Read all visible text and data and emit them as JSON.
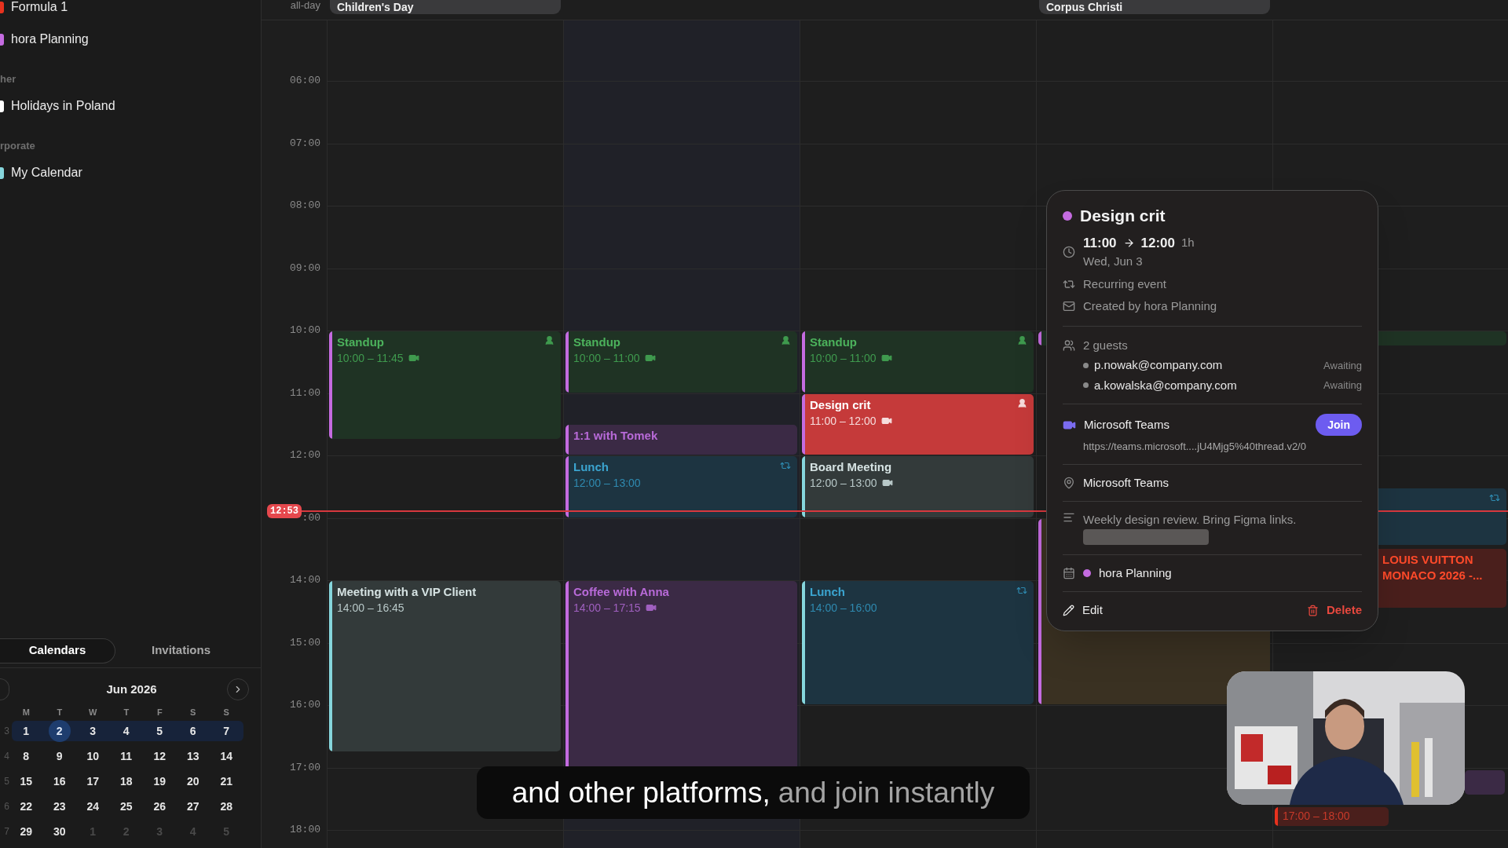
{
  "sidebar": {
    "calendars": [
      {
        "kind": "calendar",
        "name": "Formula 1",
        "color": "#e8321e"
      },
      {
        "kind": "calendar",
        "name": "hora Planning",
        "color": "#c46be0"
      },
      {
        "kind": "section",
        "name": "her"
      },
      {
        "kind": "calendar",
        "name": "Holidays in Poland",
        "color": "#ffffff"
      },
      {
        "kind": "section",
        "name": "rporate"
      },
      {
        "kind": "calendar",
        "name": "My Calendar",
        "color": "#86d6dc"
      }
    ],
    "tabs": [
      {
        "label": "Calendars",
        "selected": true
      },
      {
        "label": "Invitations",
        "selected": false
      }
    ]
  },
  "mini_calendar": {
    "month": "Jun 2026",
    "weekdays": [
      "M",
      "T",
      "W",
      "T",
      "F",
      "S",
      "S"
    ],
    "weeks": [
      {
        "number": "3",
        "selected": true,
        "days": [
          {
            "label": "1",
            "today": false,
            "outside": false
          },
          {
            "label": "2",
            "today": true,
            "outside": false
          },
          {
            "label": "3",
            "today": false,
            "outside": false
          },
          {
            "label": "4",
            "today": false,
            "outside": false
          },
          {
            "label": "5",
            "today": false,
            "outside": false
          },
          {
            "label": "6",
            "today": false,
            "outside": false
          },
          {
            "label": "7",
            "today": false,
            "outside": false
          }
        ]
      },
      {
        "number": "4",
        "selected": false,
        "days": [
          {
            "label": "8",
            "today": false,
            "outside": false
          },
          {
            "label": "9",
            "today": false,
            "outside": false
          },
          {
            "label": "10",
            "today": false,
            "outside": false
          },
          {
            "label": "11",
            "today": false,
            "outside": false
          },
          {
            "label": "12",
            "today": false,
            "outside": false
          },
          {
            "label": "13",
            "today": false,
            "outside": false
          },
          {
            "label": "14",
            "today": false,
            "outside": false
          }
        ]
      },
      {
        "number": "5",
        "selected": false,
        "days": [
          {
            "label": "15",
            "today": false,
            "outside": false
          },
          {
            "label": "16",
            "today": false,
            "outside": false
          },
          {
            "label": "17",
            "today": false,
            "outside": false
          },
          {
            "label": "18",
            "today": false,
            "outside": false
          },
          {
            "label": "19",
            "today": false,
            "outside": false
          },
          {
            "label": "20",
            "today": false,
            "outside": false
          },
          {
            "label": "21",
            "today": false,
            "outside": false
          }
        ]
      },
      {
        "number": "6",
        "selected": false,
        "days": [
          {
            "label": "22",
            "today": false,
            "outside": false
          },
          {
            "label": "23",
            "today": false,
            "outside": false
          },
          {
            "label": "24",
            "today": false,
            "outside": false
          },
          {
            "label": "25",
            "today": false,
            "outside": false
          },
          {
            "label": "26",
            "today": false,
            "outside": false
          },
          {
            "label": "27",
            "today": false,
            "outside": false
          },
          {
            "label": "28",
            "today": false,
            "outside": false
          }
        ]
      },
      {
        "number": "7",
        "selected": false,
        "days": [
          {
            "label": "29",
            "today": false,
            "outside": false
          },
          {
            "label": "30",
            "today": false,
            "outside": false
          },
          {
            "label": "1",
            "today": false,
            "outside": true
          },
          {
            "label": "2",
            "today": false,
            "outside": true
          },
          {
            "label": "3",
            "today": false,
            "outside": true
          },
          {
            "label": "4",
            "today": false,
            "outside": true
          },
          {
            "label": "5",
            "today": false,
            "outside": true
          }
        ]
      }
    ]
  },
  "calendar": {
    "allday_label": "all-day",
    "allday_events": [
      {
        "title": "Children's Day"
      },
      {
        "title": "Corpus Christi"
      }
    ],
    "hours": [
      "06:00",
      "07:00",
      "08:00",
      "09:00",
      "10:00",
      "11:00",
      "12:00",
      ":00",
      "14:00",
      "15:00",
      "16:00",
      "17:00",
      "18:00"
    ],
    "now_label": "12:53",
    "events": [
      {
        "kind": "green",
        "title": "Standup",
        "time": "10:00 – 11:45",
        "color": "#c46be0",
        "video": true,
        "guests": true,
        "recurring": false
      },
      {
        "kind": "slate",
        "title": "Meeting with a VIP Client",
        "time": "14:00 – 16:45",
        "color": "#86d6dc",
        "video": false,
        "guests": false,
        "recurring": false
      },
      {
        "kind": "green",
        "title": "Standup",
        "time": "10:00 – 11:00",
        "color": "#c46be0",
        "video": true,
        "guests": true,
        "recurring": false
      },
      {
        "kind": "purple",
        "title": "1:1 with Tomek",
        "color": "#c46be0",
        "video": false,
        "guests": false,
        "recurring": false
      },
      {
        "kind": "blue",
        "title": "Lunch",
        "time": "12:00 – 13:00",
        "color": "#c46be0",
        "video": false,
        "guests": false,
        "recurring": true
      },
      {
        "kind": "purple",
        "title": "Coffee with Anna",
        "time": "14:00 – 17:15",
        "color": "#c46be0",
        "video": true,
        "guests": false,
        "recurring": false
      },
      {
        "kind": "green",
        "title": "Standup",
        "time": "10:00 – 11:00",
        "color": "#c46be0",
        "video": true,
        "guests": true,
        "recurring": false
      },
      {
        "kind": "red",
        "title": "Design crit",
        "time": "11:00 – 12:00",
        "color": "#c46be0",
        "video": true,
        "guests": true,
        "recurring": false
      },
      {
        "kind": "slate",
        "title": "Board Meeting",
        "time": "12:00 – 13:00",
        "color": "#86d6dc",
        "video": true,
        "guests": false,
        "recurring": false
      },
      {
        "kind": "blue",
        "title": "Lunch",
        "time": "14:00 – 16:00",
        "color": "#86d6dc",
        "video": false,
        "guests": false,
        "recurring": true
      },
      {
        "kind": "green",
        "color": "#c46be0",
        "video": false,
        "guests": false,
        "recurring": false
      },
      {
        "kind": "amber",
        "color": "#c46be0",
        "video": false,
        "guests": false,
        "recurring": false
      },
      {
        "kind": "f1",
        "time": "17:00 – 18:00",
        "color": "#e8321e",
        "video": false,
        "guests": false,
        "recurring": false
      },
      {
        "kind": "green",
        "video": false,
        "guests": false,
        "recurring": false
      },
      {
        "kind": "blue",
        "video": false,
        "guests": false,
        "recurring": true
      },
      {
        "kind": "f1",
        "title": "LOUIS VUITTON MONACO 2026 -...",
        "video": false,
        "guests": false,
        "recurring": false
      },
      {
        "kind": "purple",
        "video": false,
        "guests": false,
        "recurring": false
      }
    ]
  },
  "popup": {
    "title": "Design crit",
    "color": "#c46be0",
    "start": "11:00",
    "end": "12:00",
    "duration": "1h",
    "date": "Wed, Jun 3",
    "recurrence": "Recurring event",
    "creator": "Created by hora Planning",
    "guests_label": "2 guests",
    "guests": [
      {
        "email": "p.nowak@company.com",
        "status": "Awaiting"
      },
      {
        "email": "a.kowalska@company.com",
        "status": "Awaiting"
      }
    ],
    "meeting": {
      "name": "Microsoft Teams",
      "join": "Join",
      "url": "https://teams.microsoft....jU4Mjg5%40thread.v2/0"
    },
    "location": "Microsoft Teams",
    "description": "Weekly design review. Bring Figma links.",
    "calendar": {
      "name": "hora Planning",
      "color": "#c46be0"
    },
    "edit": "Edit",
    "delete": "Delete"
  },
  "subtitle": {
    "parts": [
      {
        "text": "and other platforms,",
        "dim": false
      },
      {
        "text": "and join instantly",
        "dim": true
      }
    ]
  }
}
